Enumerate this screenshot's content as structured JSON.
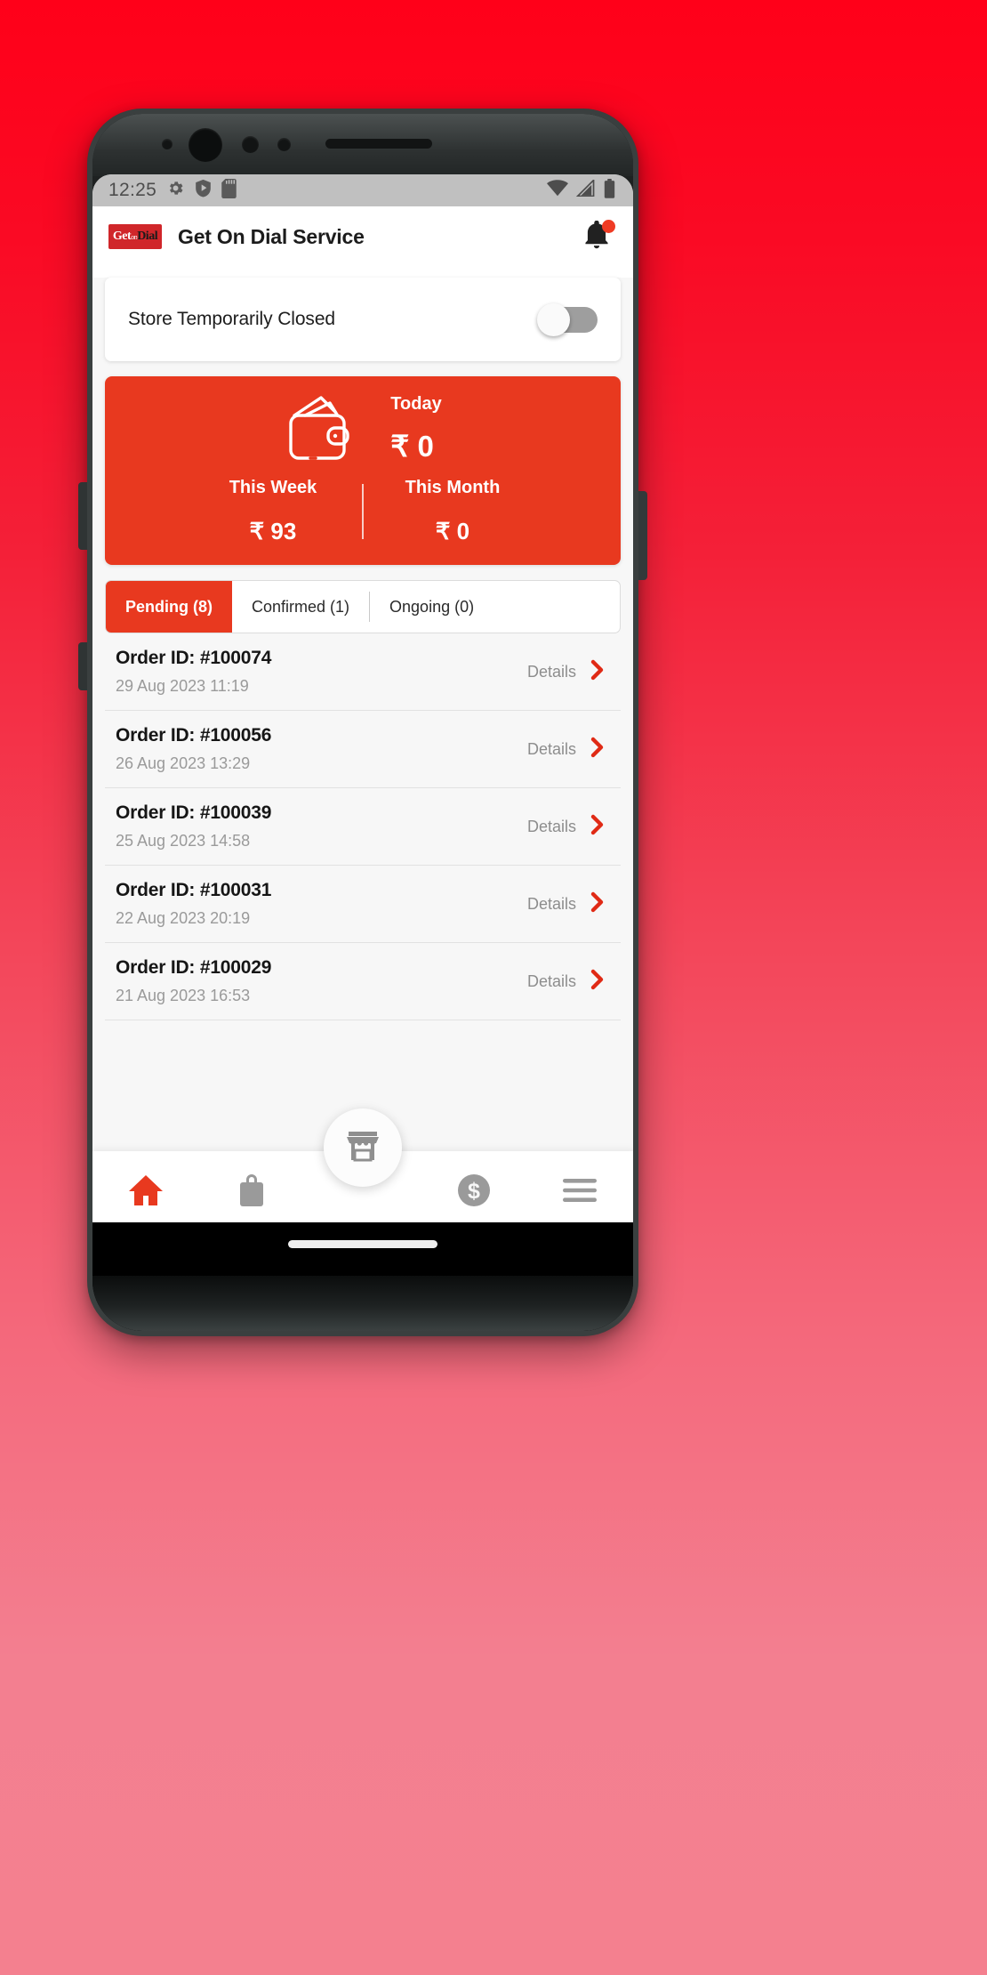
{
  "status_bar": {
    "time": "12:25",
    "left_icons": [
      "gear-icon",
      "shield-play-icon",
      "sd-card-icon"
    ],
    "right_icons": [
      "wifi-icon",
      "signal-icon",
      "battery-icon"
    ]
  },
  "app_bar": {
    "logo_get": "Get",
    "logo_on": "on",
    "logo_dial": "Dial",
    "title": "Get On Dial Service",
    "notification_icon": "bell-icon",
    "has_notification_badge": true
  },
  "store_toggle": {
    "label": "Store Temporarily Closed",
    "enabled": false
  },
  "wallet": {
    "today_label": "Today",
    "today_value": "₹ 0",
    "week_label": "This Week",
    "week_value": "₹ 93",
    "month_label": "This Month",
    "month_value": "₹ 0",
    "icon": "wallet-icon",
    "background_color": "#e8391f"
  },
  "tabs": [
    {
      "label": "Pending (8)",
      "active": true
    },
    {
      "label": "Confirmed (1)",
      "active": false
    },
    {
      "label": "Ongoing (0)",
      "active": false
    }
  ],
  "orders": [
    {
      "id": "Order ID: #100074",
      "datetime": "29 Aug 2023  11:19",
      "action": "Details"
    },
    {
      "id": "Order ID: #100056",
      "datetime": "26 Aug 2023  13:29",
      "action": "Details"
    },
    {
      "id": "Order ID: #100039",
      "datetime": "25 Aug 2023  14:58",
      "action": "Details"
    },
    {
      "id": "Order ID: #100031",
      "datetime": "22 Aug 2023  20:19",
      "action": "Details"
    },
    {
      "id": "Order ID: #100029",
      "datetime": "21 Aug 2023  16:53",
      "action": "Details"
    }
  ],
  "bottom_nav": {
    "items": [
      {
        "icon": "home-icon",
        "active": true
      },
      {
        "icon": "shopping-bag-icon",
        "active": false
      },
      {
        "icon": "dollar-coin-icon",
        "active": false
      },
      {
        "icon": "hamburger-menu-icon",
        "active": false
      }
    ],
    "fab_icon": "storefront-icon",
    "active_color": "#e8391f",
    "inactive_color": "#9a9a9a"
  },
  "theme": {
    "accent": "#e8391f",
    "background_top": "#ff0019",
    "background_bottom": "#f4808f"
  }
}
